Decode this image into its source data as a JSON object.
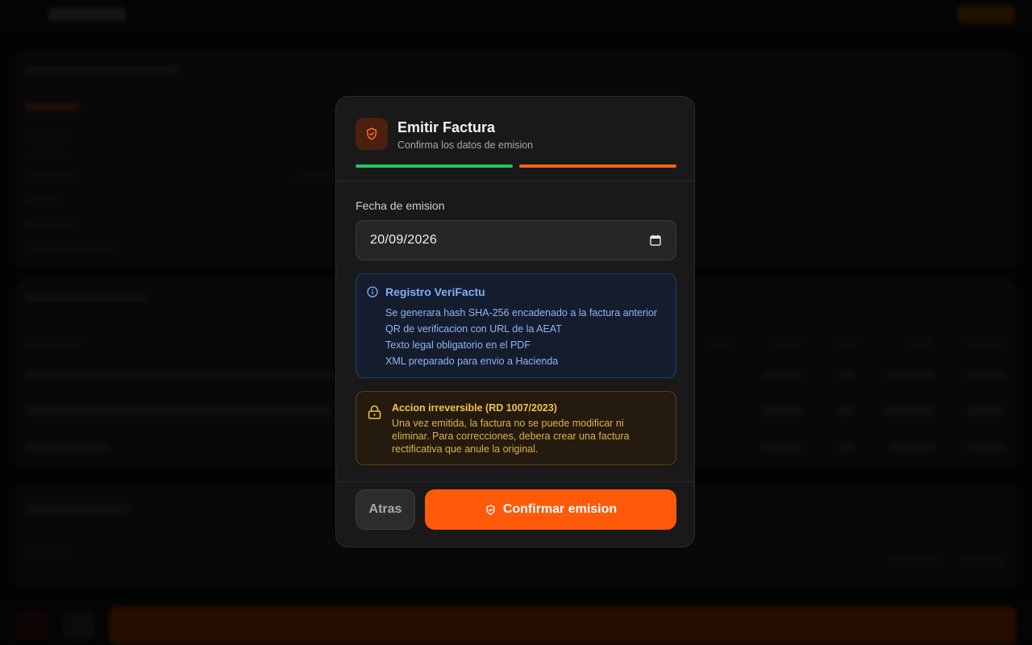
{
  "modal": {
    "title": "Emitir Factura",
    "subtitle": "Confirma los datos de emision",
    "steps": [
      {
        "status": "complete",
        "color": "#22c55e"
      },
      {
        "status": "current",
        "color": "#f2621a"
      }
    ],
    "date_field": {
      "label": "Fecha de emision",
      "value": "20/09/2026"
    },
    "verifactu": {
      "title": "Registro VeriFactu",
      "items": [
        "Se generara hash SHA-256 encadenado a la factura anterior",
        "QR de verificacion con URL de la AEAT",
        "Texto legal obligatorio en el PDF",
        "XML preparado para envio a Hacienda"
      ]
    },
    "warning": {
      "title": "Accion irreversible (RD 1007/2023)",
      "text": "Una vez emitida, la factura no se puede modificar ni eliminar. Para correcciones, debera crear una factura rectificativa que anule la original."
    },
    "buttons": {
      "back": "Atras",
      "confirm": "Confirmar emision"
    }
  },
  "colors": {
    "accent": "#ff5a0a",
    "success": "#22c55e",
    "info": "#7fb0f6",
    "warning": "#f3c24a"
  },
  "icons": {
    "header": "shield-check-icon",
    "date": "calendar-icon",
    "info": "info-icon",
    "warning": "lock-icon",
    "confirm": "shield-check-icon"
  }
}
